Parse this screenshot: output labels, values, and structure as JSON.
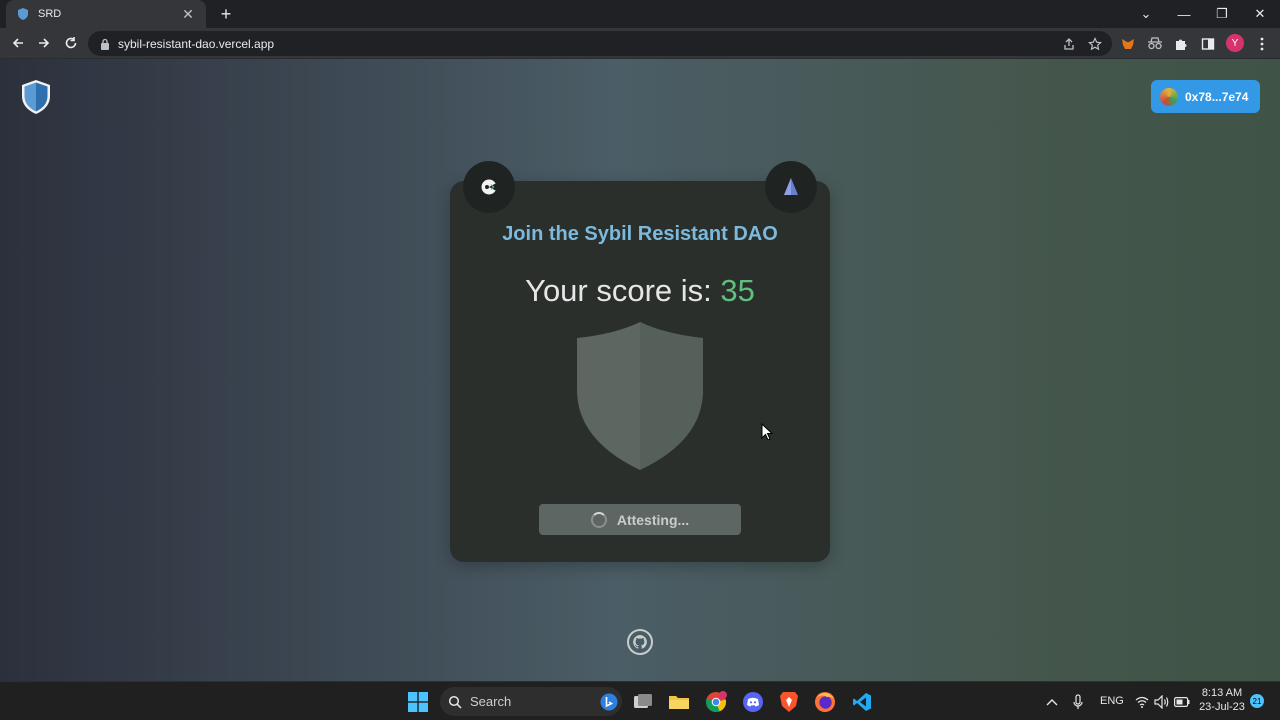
{
  "browser": {
    "tab_title": "SRD",
    "tab_close": "✕",
    "new_tab": "+",
    "url": "sybil-resistant-dao.vercel.app",
    "window_controls": {
      "tab_search": "⌄",
      "minimize": "—",
      "restore": "❐",
      "close": "✕"
    },
    "profile_initial": "Y"
  },
  "page": {
    "wallet_address": "0x78...7e74",
    "card": {
      "title": "Join the Sybil Resistant DAO",
      "score_label": "Your score is:",
      "score_value": "35",
      "attest_label": "Attesting..."
    }
  },
  "taskbar": {
    "search_placeholder": "Search",
    "language": "ENG",
    "time": "8:13 AM",
    "date": "23-Jul-23",
    "notifications": "21"
  },
  "colors": {
    "accent": "#3399e6",
    "title": "#7cb9dc",
    "score": "#5fc07d",
    "card": "#2a2f2c"
  }
}
